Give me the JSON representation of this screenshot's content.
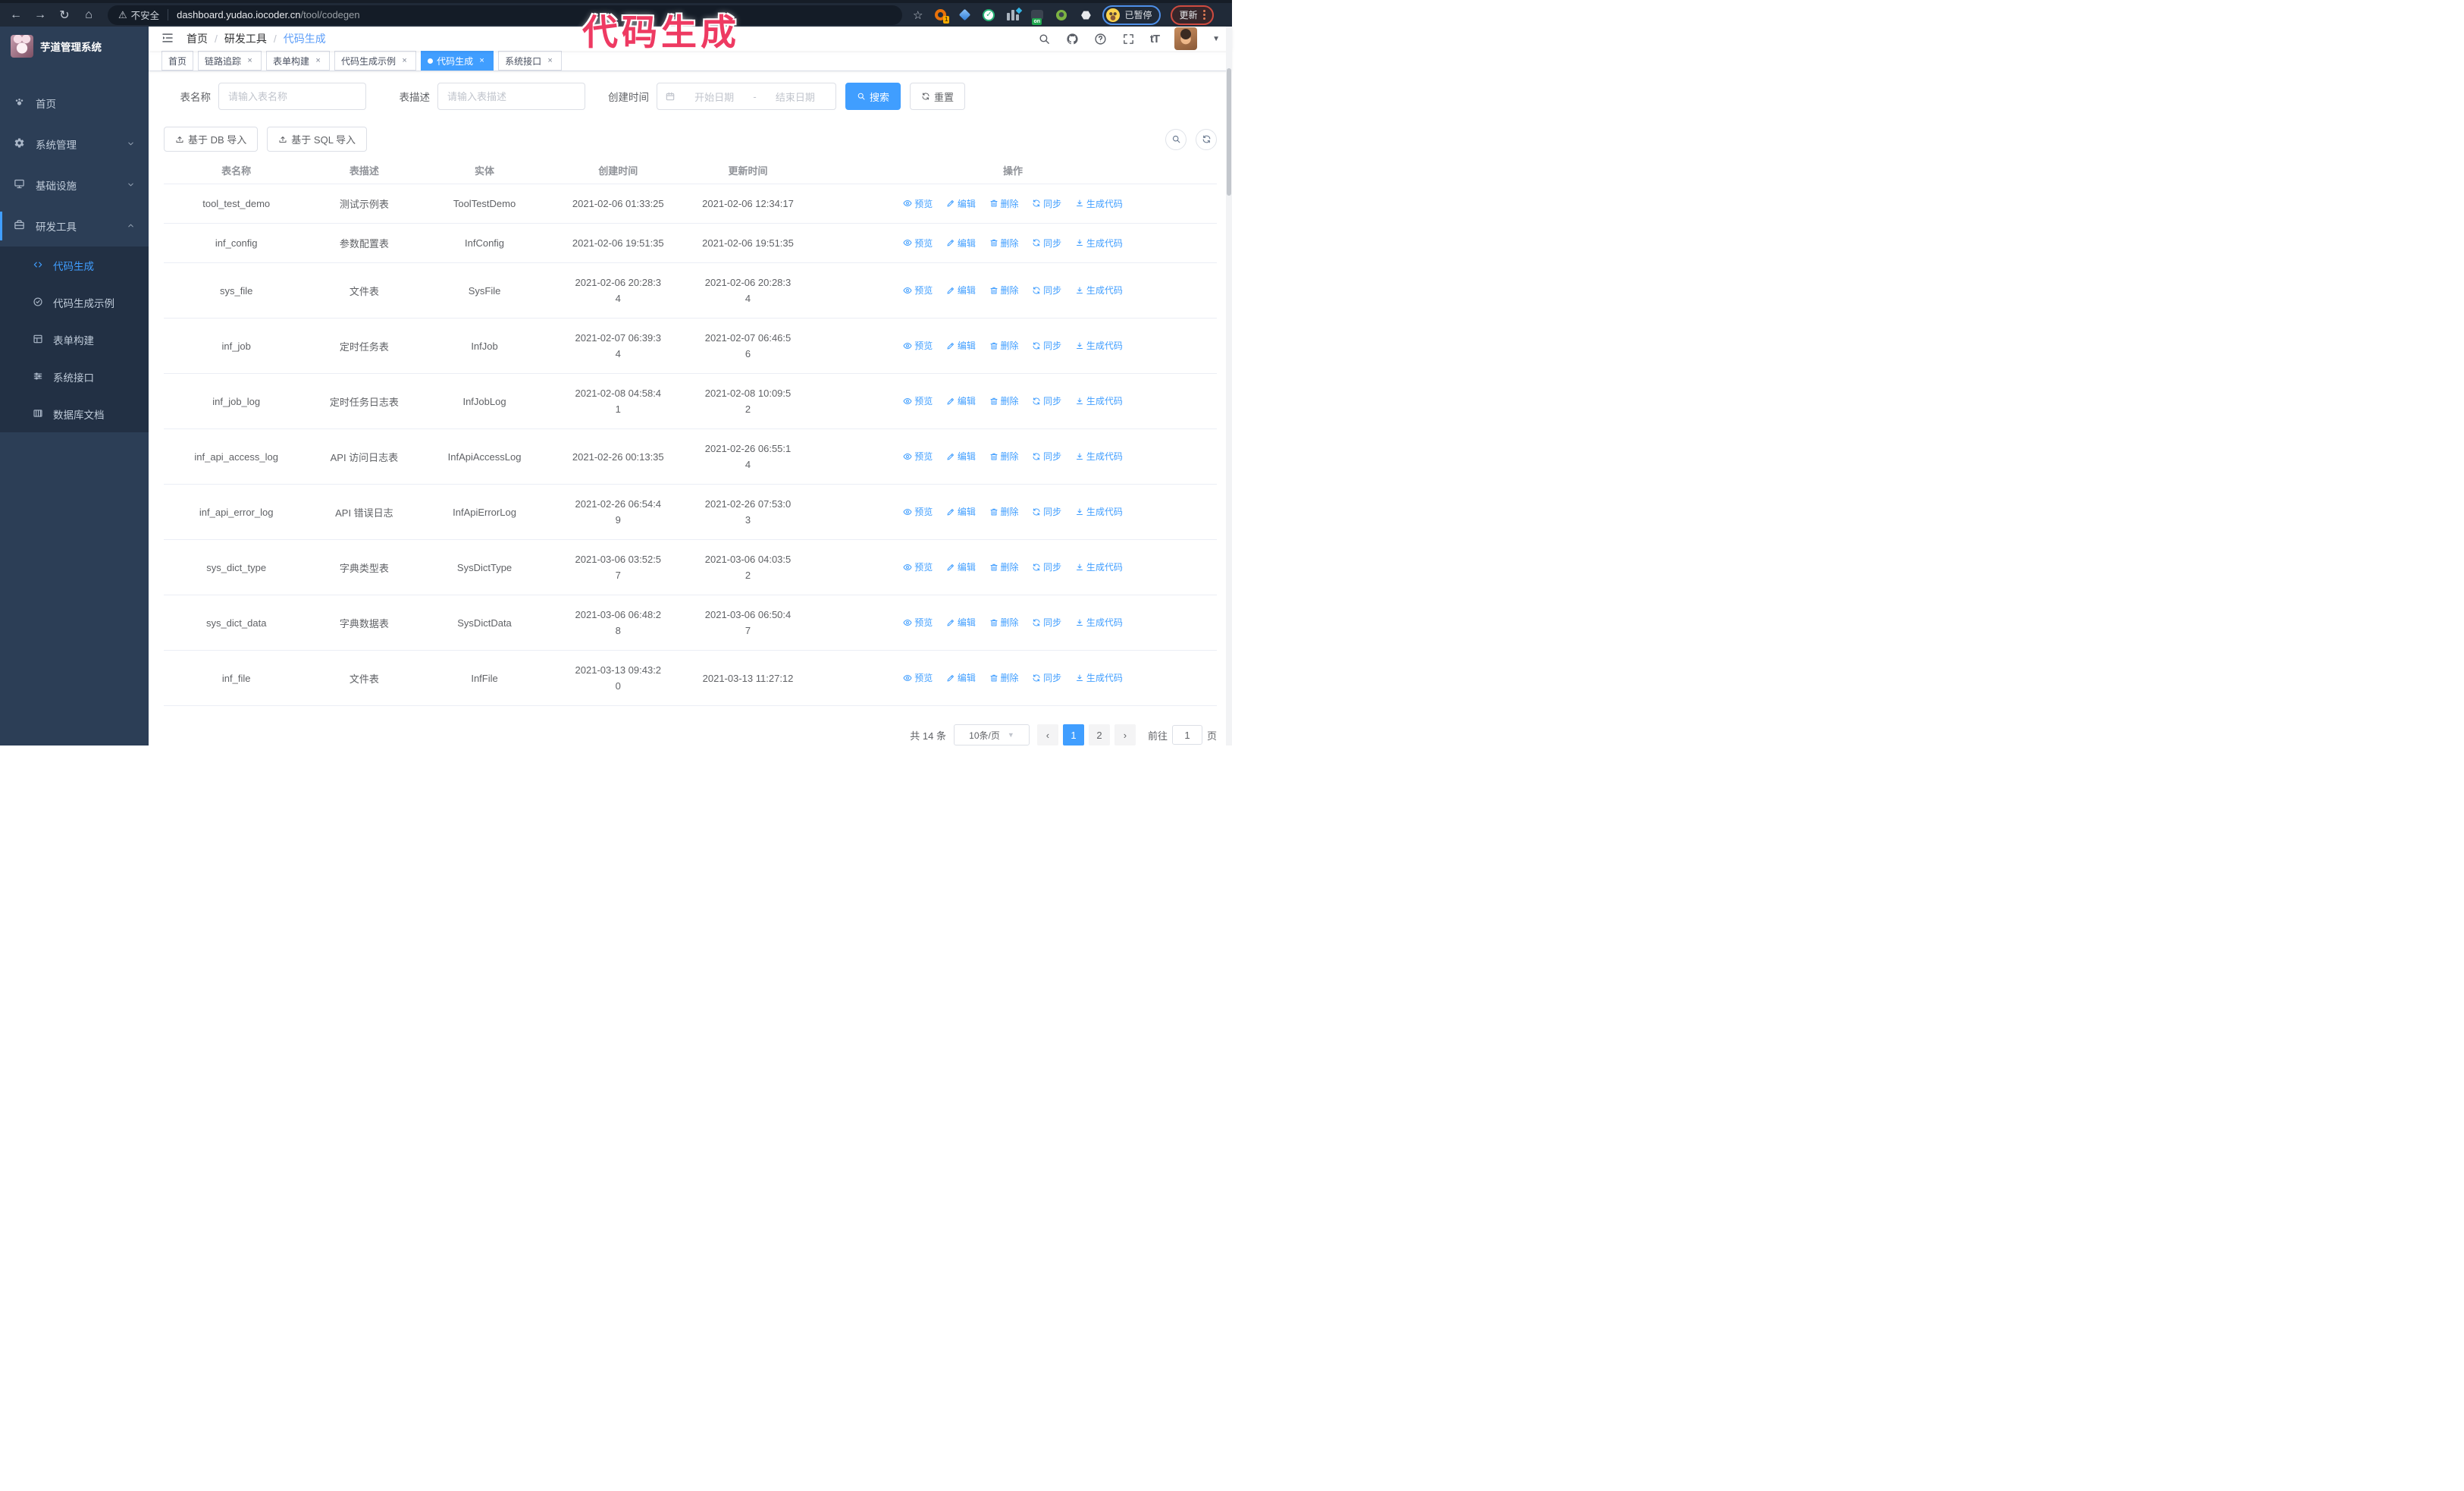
{
  "browser": {
    "security_label": "不安全",
    "url_host": "dashboard.yudao.iocoder.cn",
    "url_path": "/tool/codegen",
    "extension_badge": "1",
    "extension_on_label": "on",
    "paused_label": "已暂停",
    "update_label": "更新"
  },
  "icons": {
    "back": "←",
    "forward": "→",
    "reload": "↻",
    "home": "⌂",
    "star": "☆",
    "warning": "⚠",
    "puzzle": "⬣",
    "check": "✓",
    "font_size": "tT",
    "caret": "▼",
    "close": "×",
    "prev": "‹",
    "next": "›",
    "range_sep": "-"
  },
  "annotation": {
    "text": "代码生成",
    "color": "#ee3a62"
  },
  "sidebar": {
    "title": "芋道管理系统",
    "menu": [
      {
        "label": "首页"
      },
      {
        "label": "系统管理"
      },
      {
        "label": "基础设施"
      },
      {
        "label": "研发工具"
      }
    ],
    "submenu": [
      {
        "label": "代码生成"
      },
      {
        "label": "代码生成示例"
      },
      {
        "label": "表单构建"
      },
      {
        "label": "系统接口"
      },
      {
        "label": "数据库文档"
      }
    ]
  },
  "breadcrumb": [
    "首页",
    "研发工具",
    "代码生成"
  ],
  "tabs": [
    {
      "label": "首页"
    },
    {
      "label": "链路追踪"
    },
    {
      "label": "表单构建"
    },
    {
      "label": "代码生成示例"
    },
    {
      "label": "代码生成"
    },
    {
      "label": "系统接口"
    }
  ],
  "filters": {
    "name_label": "表名称",
    "name_placeholder": "请输入表名称",
    "desc_label": "表描述",
    "desc_placeholder": "请输入表描述",
    "time_label": "创建时间",
    "start_placeholder": "开始日期",
    "end_placeholder": "结束日期",
    "search_label": "搜索",
    "reset_label": "重置"
  },
  "toolbar": {
    "import_db_label": "基于 DB 导入",
    "import_sql_label": "基于 SQL 导入"
  },
  "table": {
    "columns": [
      "表名称",
      "表描述",
      "实体",
      "创建时间",
      "更新时间",
      "操作"
    ],
    "action_labels": [
      "预览",
      "编辑",
      "删除",
      "同步",
      "生成代码"
    ],
    "rows": [
      {
        "name": "tool_test_demo",
        "desc": "测试示例表",
        "entity": "ToolTestDemo",
        "created": "2021-02-06 01:33:25",
        "updated": "2021-02-06 12:34:17"
      },
      {
        "name": "inf_config",
        "desc": "参数配置表",
        "entity": "InfConfig",
        "created": "2021-02-06 19:51:35",
        "updated": "2021-02-06 19:51:35"
      },
      {
        "name": "sys_file",
        "desc": "文件表",
        "entity": "SysFile",
        "created": "2021-02-06 20:28:3\n4",
        "updated": "2021-02-06 20:28:3\n4"
      },
      {
        "name": "inf_job",
        "desc": "定时任务表",
        "entity": "InfJob",
        "created": "2021-02-07 06:39:3\n4",
        "updated": "2021-02-07 06:46:5\n6"
      },
      {
        "name": "inf_job_log",
        "desc": "定时任务日志表",
        "entity": "InfJobLog",
        "created": "2021-02-08 04:58:4\n1",
        "updated": "2021-02-08 10:09:5\n2"
      },
      {
        "name": "inf_api_access_log",
        "desc": "API 访问日志表",
        "entity": "InfApiAccessLog",
        "created": "2021-02-26 00:13:35",
        "updated": "2021-02-26 06:55:1\n4"
      },
      {
        "name": "inf_api_error_log",
        "desc": "API 错误日志",
        "entity": "InfApiErrorLog",
        "created": "2021-02-26 06:54:4\n9",
        "updated": "2021-02-26 07:53:0\n3"
      },
      {
        "name": "sys_dict_type",
        "desc": "字典类型表",
        "entity": "SysDictType",
        "created": "2021-03-06 03:52:5\n7",
        "updated": "2021-03-06 04:03:5\n2"
      },
      {
        "name": "sys_dict_data",
        "desc": "字典数据表",
        "entity": "SysDictData",
        "created": "2021-03-06 06:48:2\n8",
        "updated": "2021-03-06 06:50:4\n7"
      },
      {
        "name": "inf_file",
        "desc": "文件表",
        "entity": "InfFile",
        "created": "2021-03-13 09:43:2\n0",
        "updated": "2021-03-13 11:27:12"
      }
    ]
  },
  "pagination": {
    "total_label": "共 14 条",
    "page_size_label": "10条/页",
    "pages": [
      "1",
      "2"
    ],
    "active_page": "1",
    "goto_label": "前往",
    "goto_value": "1",
    "page_suffix": "页"
  },
  "colors": {
    "primary": "#409eff",
    "sidebar_bg": "#2c3e56",
    "submenu_bg": "#223044",
    "annotation": "#ee3a62"
  }
}
